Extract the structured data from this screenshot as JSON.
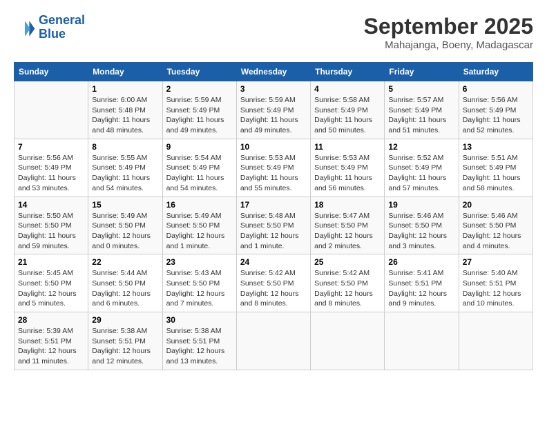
{
  "header": {
    "logo_line1": "General",
    "logo_line2": "Blue",
    "month": "September 2025",
    "location": "Mahajanga, Boeny, Madagascar"
  },
  "weekdays": [
    "Sunday",
    "Monday",
    "Tuesday",
    "Wednesday",
    "Thursday",
    "Friday",
    "Saturday"
  ],
  "weeks": [
    [
      {
        "day": "",
        "info": ""
      },
      {
        "day": "1",
        "info": "Sunrise: 6:00 AM\nSunset: 5:48 PM\nDaylight: 11 hours\nand 48 minutes."
      },
      {
        "day": "2",
        "info": "Sunrise: 5:59 AM\nSunset: 5:49 PM\nDaylight: 11 hours\nand 49 minutes."
      },
      {
        "day": "3",
        "info": "Sunrise: 5:59 AM\nSunset: 5:49 PM\nDaylight: 11 hours\nand 49 minutes."
      },
      {
        "day": "4",
        "info": "Sunrise: 5:58 AM\nSunset: 5:49 PM\nDaylight: 11 hours\nand 50 minutes."
      },
      {
        "day": "5",
        "info": "Sunrise: 5:57 AM\nSunset: 5:49 PM\nDaylight: 11 hours\nand 51 minutes."
      },
      {
        "day": "6",
        "info": "Sunrise: 5:56 AM\nSunset: 5:49 PM\nDaylight: 11 hours\nand 52 minutes."
      }
    ],
    [
      {
        "day": "7",
        "info": "Sunrise: 5:56 AM\nSunset: 5:49 PM\nDaylight: 11 hours\nand 53 minutes."
      },
      {
        "day": "8",
        "info": "Sunrise: 5:55 AM\nSunset: 5:49 PM\nDaylight: 11 hours\nand 54 minutes."
      },
      {
        "day": "9",
        "info": "Sunrise: 5:54 AM\nSunset: 5:49 PM\nDaylight: 11 hours\nand 54 minutes."
      },
      {
        "day": "10",
        "info": "Sunrise: 5:53 AM\nSunset: 5:49 PM\nDaylight: 11 hours\nand 55 minutes."
      },
      {
        "day": "11",
        "info": "Sunrise: 5:53 AM\nSunset: 5:49 PM\nDaylight: 11 hours\nand 56 minutes."
      },
      {
        "day": "12",
        "info": "Sunrise: 5:52 AM\nSunset: 5:49 PM\nDaylight: 11 hours\nand 57 minutes."
      },
      {
        "day": "13",
        "info": "Sunrise: 5:51 AM\nSunset: 5:49 PM\nDaylight: 11 hours\nand 58 minutes."
      }
    ],
    [
      {
        "day": "14",
        "info": "Sunrise: 5:50 AM\nSunset: 5:50 PM\nDaylight: 11 hours\nand 59 minutes."
      },
      {
        "day": "15",
        "info": "Sunrise: 5:49 AM\nSunset: 5:50 PM\nDaylight: 12 hours\nand 0 minutes."
      },
      {
        "day": "16",
        "info": "Sunrise: 5:49 AM\nSunset: 5:50 PM\nDaylight: 12 hours\nand 1 minute."
      },
      {
        "day": "17",
        "info": "Sunrise: 5:48 AM\nSunset: 5:50 PM\nDaylight: 12 hours\nand 1 minute."
      },
      {
        "day": "18",
        "info": "Sunrise: 5:47 AM\nSunset: 5:50 PM\nDaylight: 12 hours\nand 2 minutes."
      },
      {
        "day": "19",
        "info": "Sunrise: 5:46 AM\nSunset: 5:50 PM\nDaylight: 12 hours\nand 3 minutes."
      },
      {
        "day": "20",
        "info": "Sunrise: 5:46 AM\nSunset: 5:50 PM\nDaylight: 12 hours\nand 4 minutes."
      }
    ],
    [
      {
        "day": "21",
        "info": "Sunrise: 5:45 AM\nSunset: 5:50 PM\nDaylight: 12 hours\nand 5 minutes."
      },
      {
        "day": "22",
        "info": "Sunrise: 5:44 AM\nSunset: 5:50 PM\nDaylight: 12 hours\nand 6 minutes."
      },
      {
        "day": "23",
        "info": "Sunrise: 5:43 AM\nSunset: 5:50 PM\nDaylight: 12 hours\nand 7 minutes."
      },
      {
        "day": "24",
        "info": "Sunrise: 5:42 AM\nSunset: 5:50 PM\nDaylight: 12 hours\nand 8 minutes."
      },
      {
        "day": "25",
        "info": "Sunrise: 5:42 AM\nSunset: 5:50 PM\nDaylight: 12 hours\nand 8 minutes."
      },
      {
        "day": "26",
        "info": "Sunrise: 5:41 AM\nSunset: 5:51 PM\nDaylight: 12 hours\nand 9 minutes."
      },
      {
        "day": "27",
        "info": "Sunrise: 5:40 AM\nSunset: 5:51 PM\nDaylight: 12 hours\nand 10 minutes."
      }
    ],
    [
      {
        "day": "28",
        "info": "Sunrise: 5:39 AM\nSunset: 5:51 PM\nDaylight: 12 hours\nand 11 minutes."
      },
      {
        "day": "29",
        "info": "Sunrise: 5:38 AM\nSunset: 5:51 PM\nDaylight: 12 hours\nand 12 minutes."
      },
      {
        "day": "30",
        "info": "Sunrise: 5:38 AM\nSunset: 5:51 PM\nDaylight: 12 hours\nand 13 minutes."
      },
      {
        "day": "",
        "info": ""
      },
      {
        "day": "",
        "info": ""
      },
      {
        "day": "",
        "info": ""
      },
      {
        "day": "",
        "info": ""
      }
    ]
  ]
}
